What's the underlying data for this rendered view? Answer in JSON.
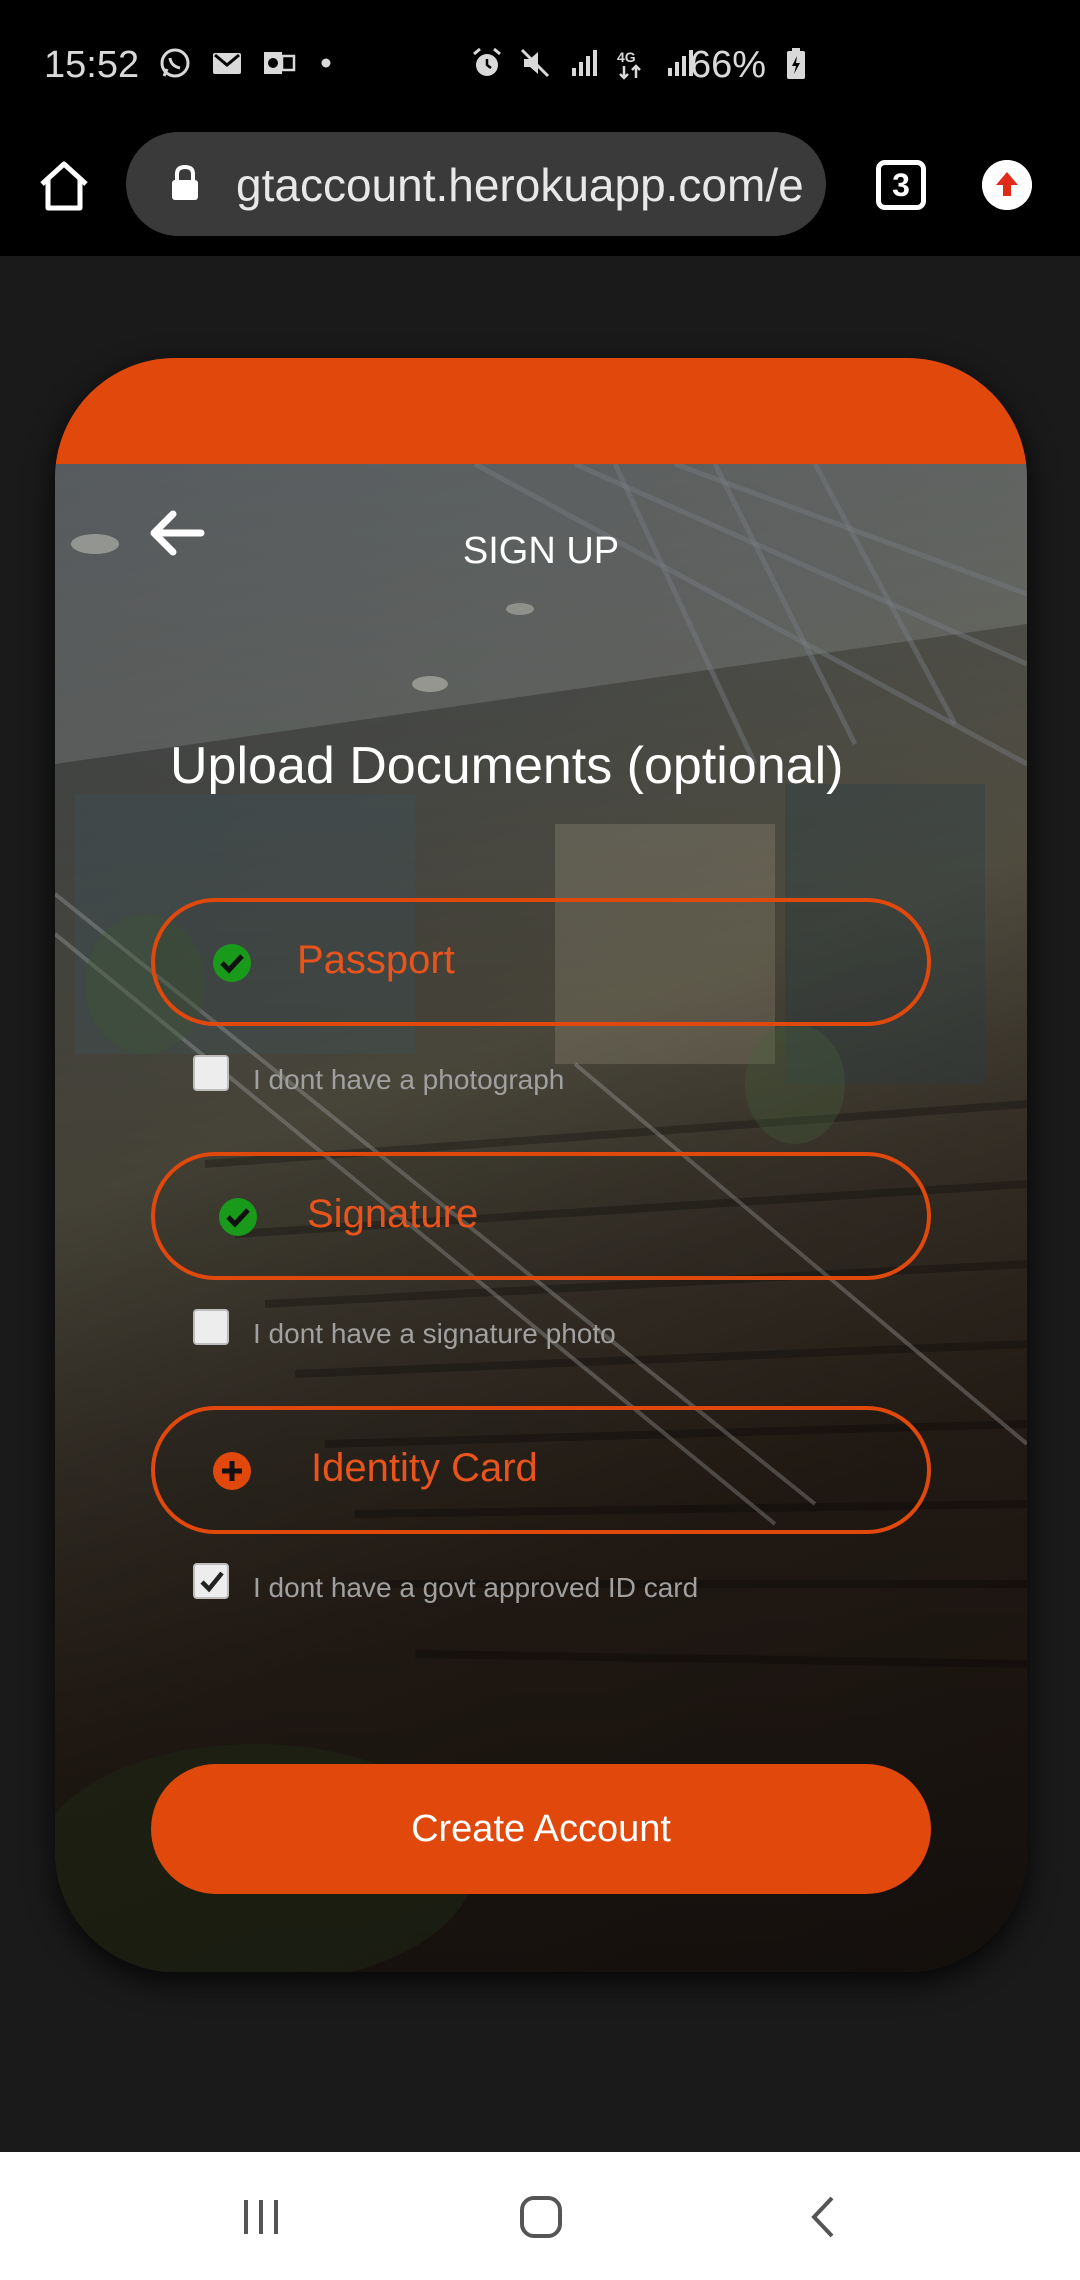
{
  "status_bar": {
    "time": "15:52",
    "battery": "66%",
    "left_icons": [
      "whatsapp-icon",
      "gmail-icon",
      "outlook-icon",
      "dot-icon"
    ],
    "right_icons": [
      "alarm-icon",
      "mute-icon",
      "signal-icon",
      "4g-icon",
      "signal-icon"
    ]
  },
  "browser": {
    "url": "gtaccount.herokuapp.com/e",
    "tab_count": "3"
  },
  "page": {
    "title": "SIGN UP",
    "heading": "Upload Documents (optional)",
    "documents": [
      {
        "label": "Passport",
        "status": "uploaded",
        "checkbox_label": "I dont have a photograph",
        "checked": false
      },
      {
        "label": "Signature",
        "status": "uploaded",
        "checkbox_label": "I dont have a signature photo",
        "checked": false
      },
      {
        "label": "Identity Card",
        "status": "add",
        "checkbox_label": "I dont have a govt approved ID card",
        "checked": true
      }
    ],
    "create_button": "Create Account"
  },
  "colors": {
    "accent": "#e0480c",
    "success": "#1a9a1a",
    "background": "#1a1a1a"
  }
}
